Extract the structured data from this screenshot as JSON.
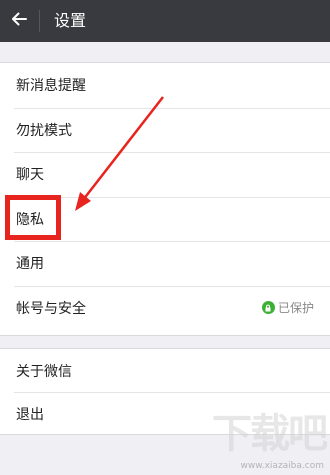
{
  "header": {
    "title": "设置",
    "back_icon": "back-arrow-icon"
  },
  "settings_group_1": [
    {
      "label": "新消息提醒"
    },
    {
      "label": "勿扰模式"
    },
    {
      "label": "聊天"
    },
    {
      "label": "隐私"
    },
    {
      "label": "通用"
    },
    {
      "label": "帐号与安全",
      "status": "已保护",
      "status_icon": "lock-icon"
    }
  ],
  "settings_group_2": [
    {
      "label": "关于微信"
    },
    {
      "label": "退出"
    }
  ],
  "annotation": {
    "highlight_color": "#e8241f"
  },
  "watermark": {
    "logo_text": "下载吧",
    "url": "www.xiazaiba.com"
  },
  "colors": {
    "topbar": "#393a3f",
    "background": "#efeff4",
    "lock_green": "#3cb034"
  }
}
